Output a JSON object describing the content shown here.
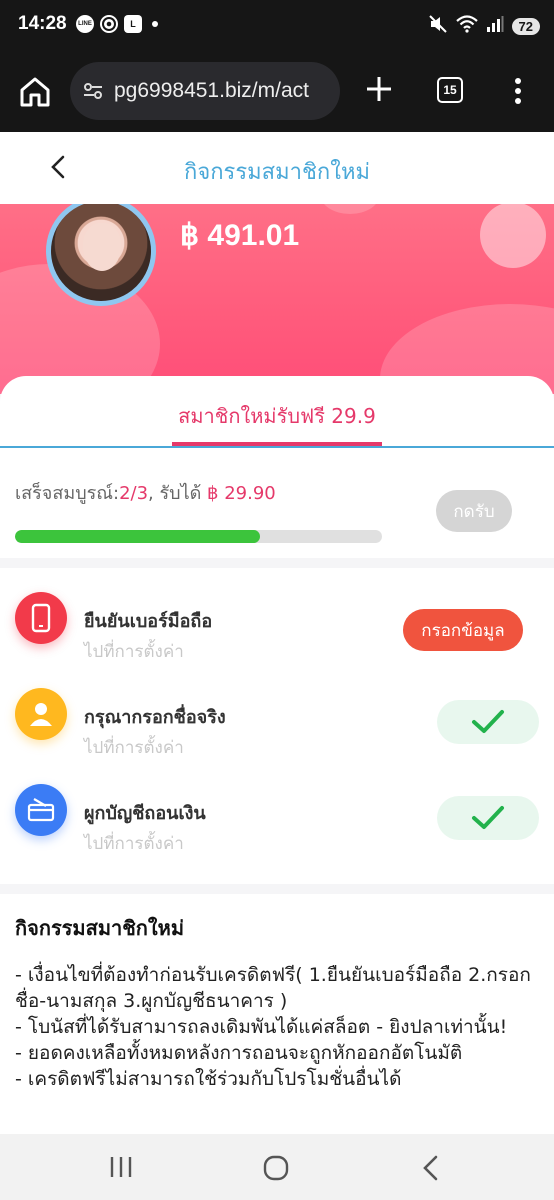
{
  "status_bar": {
    "time": "14:28",
    "app_icons": [
      "LINE",
      "chrome-icon",
      "L"
    ],
    "battery": "72"
  },
  "browser": {
    "url": "pg6998451.biz/m/act",
    "tab_count": "15"
  },
  "header": {
    "title": "กิจกรรมสมาชิกใหม่"
  },
  "profile": {
    "balance": "฿ 491.01"
  },
  "tab": {
    "label": "สมาชิกใหม่รับฟรี 29.9"
  },
  "progress": {
    "prefix": "เสร็จสมบูรณ์:",
    "count": "2/3",
    "middle": ", รับได้ ",
    "reward": "฿ 29.90",
    "claim_button": "กดรับ",
    "fraction": 0.667
  },
  "tasks": [
    {
      "title": "ยืนยันเบอร์มือถือ",
      "subtitle": "ไปที่การตั้งค่า",
      "action": "กรอกข้อมูล",
      "done": false,
      "icon": "phone-icon",
      "color": "#f23a4a"
    },
    {
      "title": "กรุณากรอกชื่อจริง",
      "subtitle": "ไปที่การตั้งค่า",
      "action": "",
      "done": true,
      "icon": "user-icon",
      "color": "#ffb81f"
    },
    {
      "title": "ผูกบัญชีถอนเงิน",
      "subtitle": "ไปที่การตั้งค่า",
      "action": "",
      "done": true,
      "icon": "card-icon",
      "color": "#3b7cf5"
    }
  ],
  "description": {
    "title": "กิจกรรมสมาชิกใหม่",
    "lines": [
      "- เงื่อนไขที่ต้องทำก่อนรับเครดิตฟรี( 1.ยืนยันเบอร์มือถือ  2.กรอกชื่อ-นามสกุล  3.ผูกบัญชีธนาคาร )",
      "- โบนัสที่ได้รับสามารถลงเดิมพันได้แค่สล็อต - ยิงปลาเท่านั้น!",
      "- ยอดคงเหลือทั้งหมดหลังการถอนจะถูกหักออกอัตโนมัติ",
      "- เครดิตฟรีไม่สามารถใช้ร่วมกับโปรโมชั่นอื่นได้"
    ]
  }
}
